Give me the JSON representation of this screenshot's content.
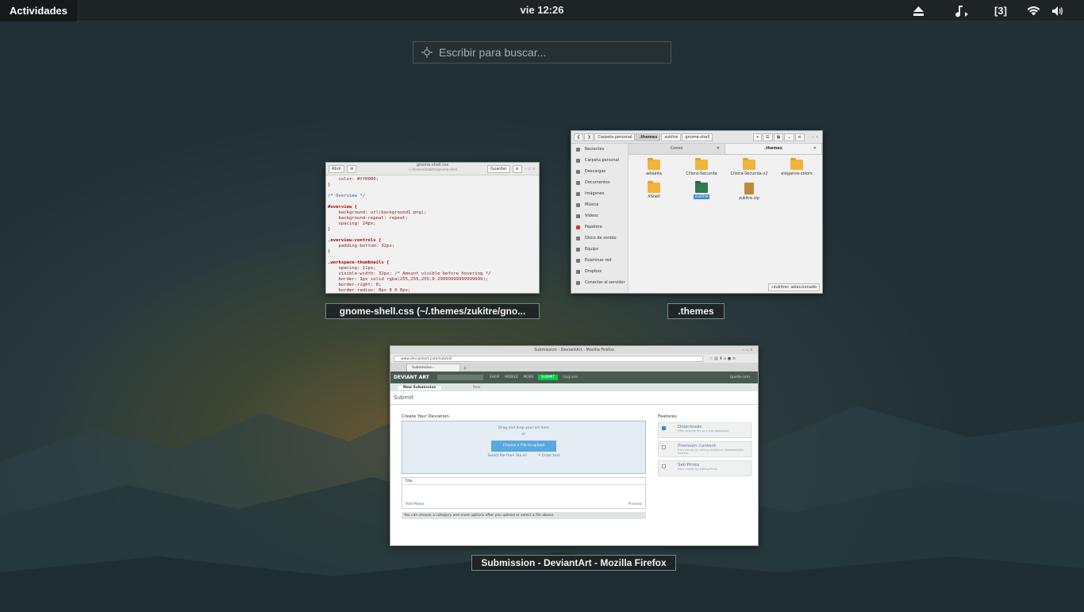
{
  "topbar": {
    "activities": "Actividades",
    "clock": "vie 12:26",
    "workspace_indicator": "[3]",
    "icons": [
      "eject-icon",
      "music-note-icon",
      "wifi-icon",
      "volume-icon"
    ]
  },
  "search": {
    "placeholder": "Escribir para buscar..."
  },
  "windows": {
    "editor": {
      "caption": "gnome-shell.css (~/.themes/zukitre/gno...",
      "title": "gnome-shell.css",
      "subtitle": "~/.themes/zukitre/gnome-shell",
      "open_label": "Abrir",
      "save_label": "Guardar",
      "code": [
        "    color: #ff0000;",
        "}",
        "",
        "/* Overview */",
        "",
        "#overview {",
        "    background: url(background1.png);",
        "    background-repeat: repeat;",
        "    spacing: 24px;",
        "}",
        "",
        ".overview-controls {",
        "    padding-bottom: 32px;",
        "}",
        "",
        ".workspace-thumbnails {",
        "    spacing: 11px;",
        "    visible-width: 32px; /* Amount visible before hovering */",
        "    border: 1px solid rgba(255,255,255,0.29999999999999999);",
        "    border-right: 0;",
        "    border-radius: 0px 0 0 0px;"
      ]
    },
    "files": {
      "caption": ".themes",
      "breadcrumbs": [
        "Carpeta personal",
        ".themes",
        "zukitre",
        "gnome-shell"
      ],
      "sidebar": [
        "Recientes",
        "Carpeta personal",
        "Descargas",
        "Documentos",
        "Imágenes",
        "Música",
        "Vídeos",
        "Papelera",
        "Disco de sonido",
        "Equipo",
        "Examinar red",
        "Dropbox",
        "Conectar al servidor"
      ],
      "tabs": [
        "Conos",
        ".themes"
      ],
      "items": [
        {
          "name": "adwaita",
          "kind": "folder"
        },
        {
          "name": "Ciliora-Secunda",
          "kind": "folder"
        },
        {
          "name": "Ciliora-Secunda-v2",
          "kind": "folder"
        },
        {
          "name": "elegance-colors",
          "kind": "folder"
        },
        {
          "name": "XShell",
          "kind": "folder"
        },
        {
          "name": "zukitre",
          "kind": "folder-selected"
        },
        {
          "name": "zukitre.zip",
          "kind": "zip"
        }
      ],
      "status": "«zukitre» seleccionado"
    },
    "firefox": {
      "caption": "Submission - DeviantArt - Mozilla Firefox",
      "title": "Submission - DeviantArt - Mozilla Firefox",
      "url": "www.deviantart.com/submit/",
      "tab": "Submission - DeviantArt",
      "logo": "DEVIANT ART",
      "nav": [
        "SHOP",
        "MOBILE",
        "MORE"
      ],
      "submit_button": "SUBMIT",
      "upgrade": "Upgrade",
      "user": "Ipaste.com",
      "subtabs": [
        "New Submission",
        "New"
      ],
      "subnav_submit": "Submit",
      "create_heading": "Create Your Deviation",
      "drop_text": "Drag and drop your art here",
      "drop_or": "or",
      "choose_file": "Choose a File to upload",
      "stash_link": "Select file from Sta.sh",
      "text_link": "✎ Enter text",
      "title_label": "Title",
      "add_media": "Add Media",
      "preview": "Preview",
      "note": "You can choose a category and more options after you upload or select a file above.",
      "features_heading": "Features",
      "features": [
        {
          "title": "Downloads",
          "desc": "Offer original file as a free download",
          "checked": true
        },
        {
          "title": "Premium Content",
          "desc": "Earn money by selling additional downloadable content",
          "checked": false
        },
        {
          "title": "Sell Prints",
          "desc": "Earn money by selling Prints",
          "checked": false
        }
      ]
    }
  }
}
